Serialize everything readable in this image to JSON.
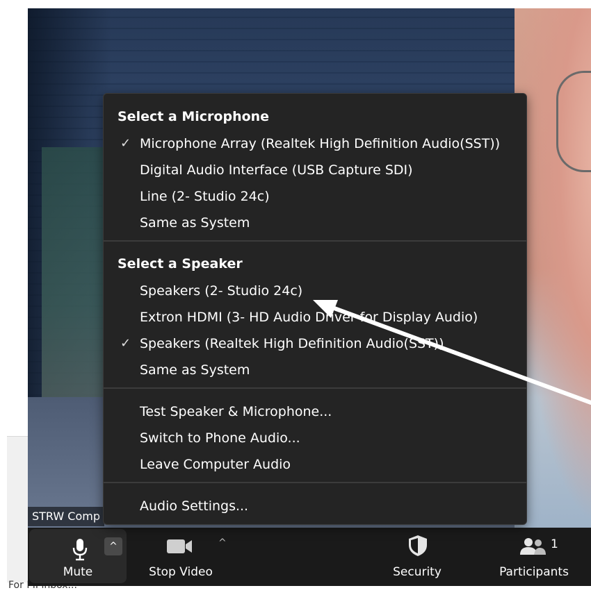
{
  "behind_window_text": "For PII inbox...",
  "video": {
    "participant_label": "STRW Comp"
  },
  "toolbar": {
    "mute_label": "Mute",
    "stop_video_label": "Stop Video",
    "security_label": "Security",
    "participants_label": "Participants",
    "participants_count": "1"
  },
  "audio_menu": {
    "microphone_header": "Select a Microphone",
    "microphones": [
      {
        "label": "Microphone Array (Realtek High Definition Audio(SST))",
        "selected": true
      },
      {
        "label": "Digital Audio Interface (USB Capture SDI)",
        "selected": false
      },
      {
        "label": "Line (2- Studio 24c)",
        "selected": false
      },
      {
        "label": "Same as System",
        "selected": false
      }
    ],
    "speaker_header": "Select a Speaker",
    "speakers": [
      {
        "label": "Speakers (2- Studio 24c)",
        "selected": false
      },
      {
        "label": "Extron HDMI (3- HD Audio Driver for Display Audio)",
        "selected": false
      },
      {
        "label": "Speakers (Realtek High Definition Audio(SST))",
        "selected": true
      },
      {
        "label": "Same as System",
        "selected": false
      }
    ],
    "actions": [
      {
        "label": "Test Speaker & Microphone..."
      },
      {
        "label": "Switch to Phone Audio..."
      },
      {
        "label": "Leave Computer Audio"
      }
    ],
    "settings_label": "Audio Settings...",
    "check_glyph": "✓"
  },
  "colors": {
    "menu_bg": "#242424",
    "toolbar_bg": "#1a1a1a",
    "annotation_arrow": "#ffffff"
  }
}
